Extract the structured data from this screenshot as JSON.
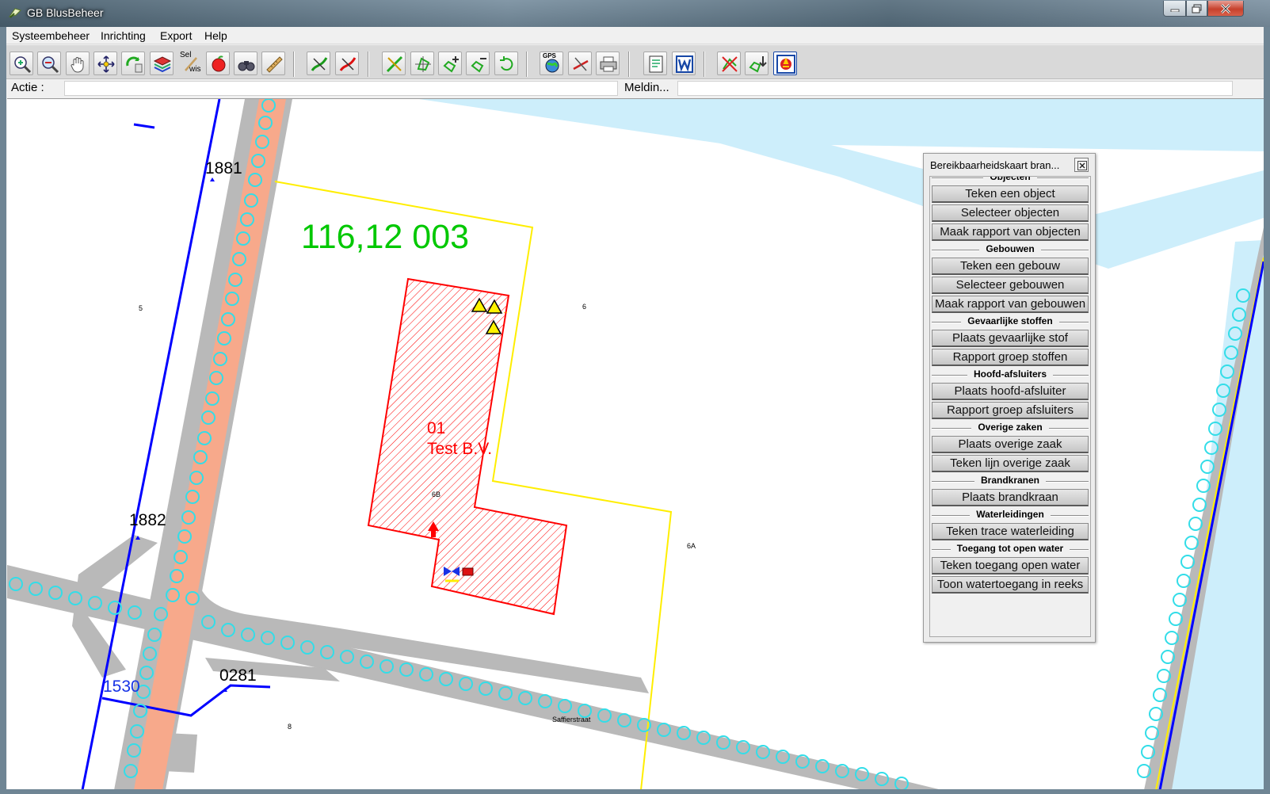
{
  "window": {
    "title": "GB BlusBeheer"
  },
  "menu": [
    "Systeembeheer",
    "Inrichting",
    "Export",
    "Help"
  ],
  "toolbar": {
    "icons": [
      "zoom-in-icon",
      "zoom-out-icon",
      "pan-hand-icon",
      "zoom-extent-icon",
      "refresh-view-icon",
      "layers-icon",
      "select-erase-icon",
      "apple-marker-icon",
      "binoculars-icon",
      "ruler-icon",
      "draw-line-green-icon",
      "delete-line-red-icon",
      "edit-tools-icon",
      "node-edit-icon",
      "add-vertex-icon",
      "remove-vertex-icon",
      "rotate-icon",
      "gps-globe-icon",
      "cut-line-icon",
      "print-icon",
      "report-icon",
      "word-export-icon",
      "delete-object-icon",
      "move-down-icon",
      "fire-alarm-icon"
    ],
    "select_label_top": "Sel",
    "select_label_bottom": "wis",
    "gps_label": "GPS"
  },
  "status": {
    "action_label": "Actie :",
    "action_value": "",
    "message_label": "Meldin...",
    "message_value": ""
  },
  "map": {
    "parcel_number": "116,12 003",
    "building_code": "01",
    "building_name": "Test B.V.",
    "pipe_labels": [
      "1881",
      "1882",
      "0281",
      "1530"
    ],
    "house_numbers": [
      "5",
      "6",
      "6B",
      "6A",
      "8"
    ],
    "street_name": "Saffierstraat",
    "colors": {
      "building": "#ff0000",
      "parcel": "#ffee00",
      "pipe": "#0000ff",
      "water": "#cdeefb",
      "road": "#b9b9b9",
      "hydrant": "#33dde8",
      "parcel_label": "#00c800"
    }
  },
  "panel": {
    "title": "Bereikbaarheidskaart bran...",
    "sections": [
      {
        "title": "Objecten",
        "buttons": [
          "Teken een object",
          "Selecteer objecten",
          "Maak rapport van objecten"
        ]
      },
      {
        "title": "Gebouwen",
        "buttons": [
          "Teken een gebouw",
          "Selecteer gebouwen",
          "Maak rapport van gebouwen"
        ]
      },
      {
        "title": "Gevaarlijke stoffen",
        "buttons": [
          "Plaats gevaarlijke stof",
          "Rapport groep stoffen"
        ]
      },
      {
        "title": "Hoofd-afsluiters",
        "buttons": [
          "Plaats hoofd-afsluiter",
          "Rapport groep afsluiters"
        ]
      },
      {
        "title": "Overige zaken",
        "buttons": [
          "Plaats overige zaak",
          "Teken lijn overige zaak"
        ]
      },
      {
        "title": "Brandkranen",
        "buttons": [
          "Plaats brandkraan"
        ]
      },
      {
        "title": "Waterleidingen",
        "buttons": [
          "Teken trace waterleiding"
        ]
      },
      {
        "title": "Toegang tot open water",
        "buttons": [
          "Teken toegang open water",
          "Toon watertoegang in reeks"
        ]
      }
    ]
  }
}
